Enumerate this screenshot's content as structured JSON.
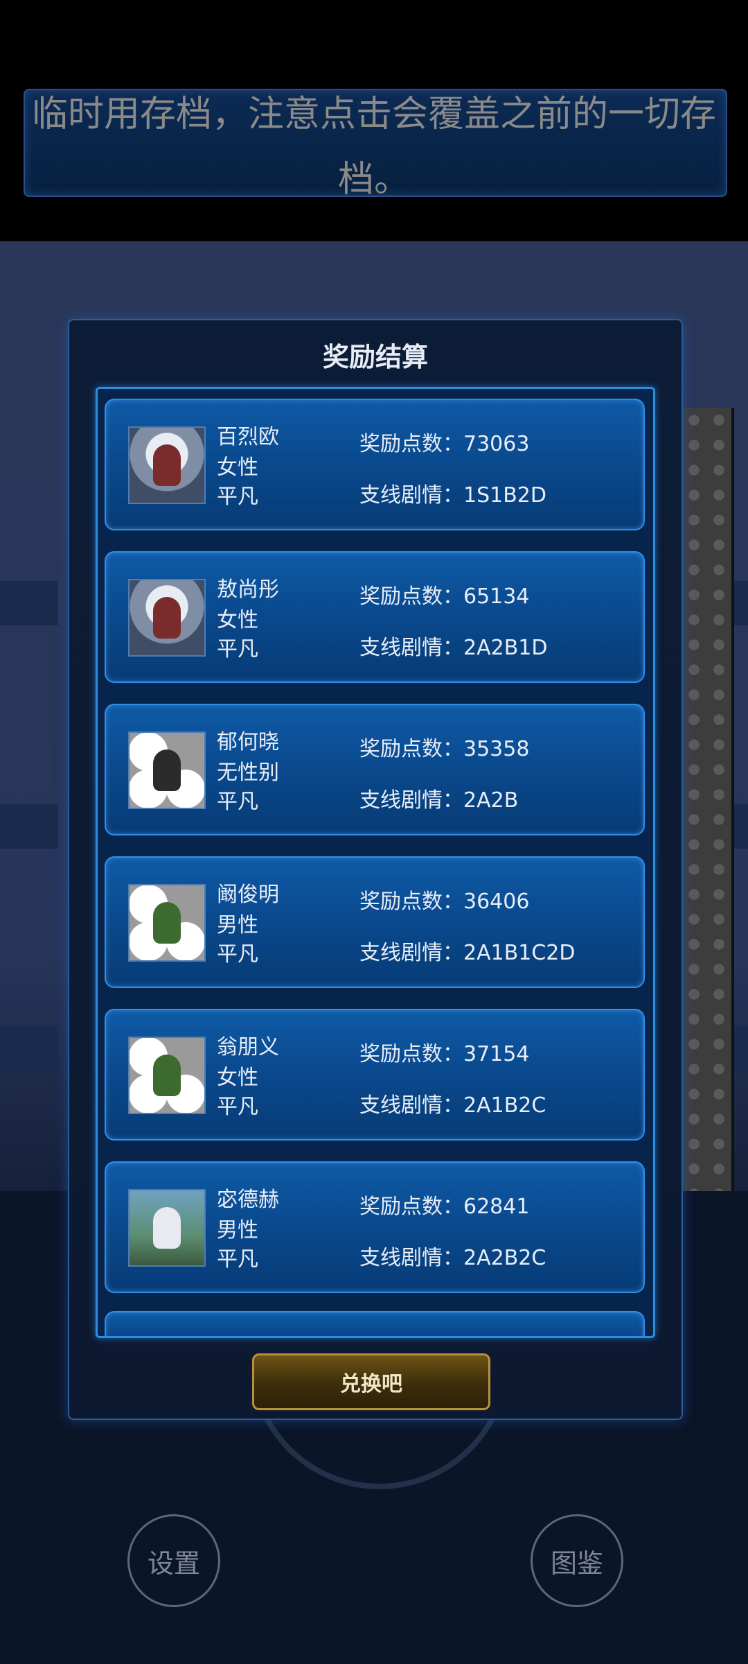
{
  "toast": {
    "text": "临时用存档，注意点击会覆盖之前的一切存档。"
  },
  "dialog": {
    "title": "奖励结算",
    "points_label": "奖励点数：",
    "branch_label": "支线剧情：",
    "confirm_label": "兑换吧",
    "cards": [
      {
        "name": "百烈欧",
        "gender": "女性",
        "rank": "平凡",
        "points": "73063",
        "branch": "1S1B2D",
        "avatar": "moon-girl-avatar"
      },
      {
        "name": "敖尚彤",
        "gender": "女性",
        "rank": "平凡",
        "points": "65134",
        "branch": "2A2B1D",
        "avatar": "moon-girl-avatar"
      },
      {
        "name": "郁何晓",
        "gender": "无性别",
        "rank": "平凡",
        "points": "35358",
        "branch": "2A2B",
        "avatar": "chibi-avatar"
      },
      {
        "name": "阚俊明",
        "gender": "男性",
        "rank": "平凡",
        "points": "36406",
        "branch": "2A1B1C2D",
        "avatar": "chibi-avatar"
      },
      {
        "name": "翁朋义",
        "gender": "女性",
        "rank": "平凡",
        "points": "37154",
        "branch": "2A1B2C",
        "avatar": "chibi-avatar"
      },
      {
        "name": "宓德赫",
        "gender": "男性",
        "rank": "平凡",
        "points": "62841",
        "branch": "2A2B2C",
        "avatar": "garden-avatar"
      }
    ]
  },
  "bottom_nav": {
    "settings_label": "设置",
    "gallery_label": "图鉴"
  }
}
